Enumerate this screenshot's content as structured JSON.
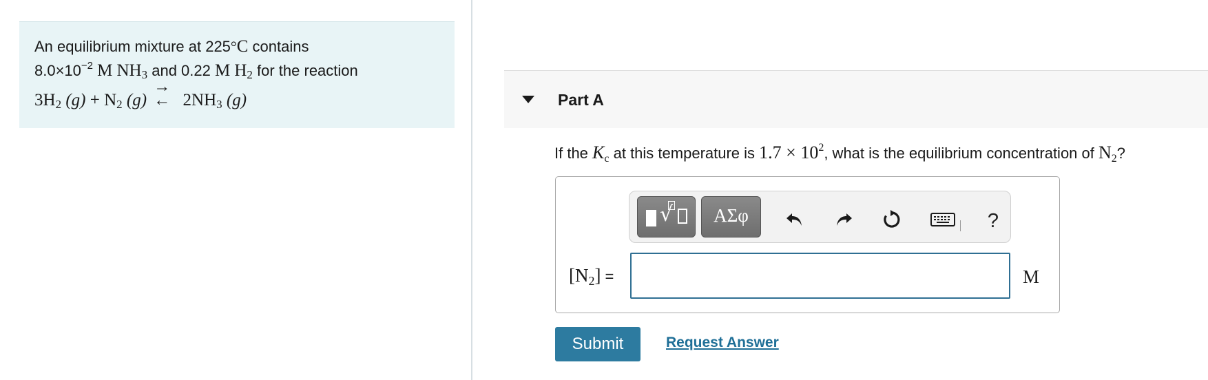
{
  "intro": {
    "line1_text": "An equilibrium mixture at 225",
    "line1_degree": "°",
    "line1_unit": "C",
    "line1_tail": " contains",
    "line2_value1": "8.0×10",
    "line2_exp": "−2",
    "line2_unit1": "M",
    "line2_species1": "NH",
    "line2_species1_sub": "3",
    "line2_mid": " and 0.22 ",
    "line2_unit2": "M",
    "line2_species2": "H",
    "line2_species2_sub": "2",
    "line2_tail": " for the reaction",
    "reaction": {
      "reactant1_coef": "3H",
      "reactant1_sub": "2",
      "reactant1_state": "(g)",
      "plus": "+",
      "reactant2": "N",
      "reactant2_sub": "2",
      "reactant2_state": "(g)",
      "arrow_forward": "→",
      "arrow_reverse": "←",
      "product_coef": "2NH",
      "product_sub": "3",
      "product_state": "(g)"
    }
  },
  "part": {
    "title": "Part A"
  },
  "question": {
    "prefix": "If the ",
    "k_symbol": "K",
    "k_sub": "c",
    "middle": " at this temperature is ",
    "value": "1.7 × 10",
    "value_exp": "2",
    "tail": ", what is the equilibrium concentration of ",
    "species": "N",
    "species_sub": "2",
    "qmark": "?"
  },
  "answer": {
    "label_open": "[N",
    "label_sub": "2",
    "label_close": "]",
    "label_eq": "=",
    "input_value": "",
    "unit": "M"
  },
  "toolbar": {
    "greek_label": "ΑΣφ",
    "help_label": "?",
    "icons": [
      "templates-icon",
      "greek-letters-icon",
      "undo-icon",
      "redo-icon",
      "reset-icon",
      "keyboard-icon",
      "help-icon"
    ]
  },
  "actions": {
    "submit_label": "Submit",
    "request_label": "Request Answer"
  },
  "colors": {
    "intro_bg": "#e8f4f6",
    "accent": "#2d7ba0",
    "link": "#1f6f97",
    "input_border": "#2f6f93"
  }
}
